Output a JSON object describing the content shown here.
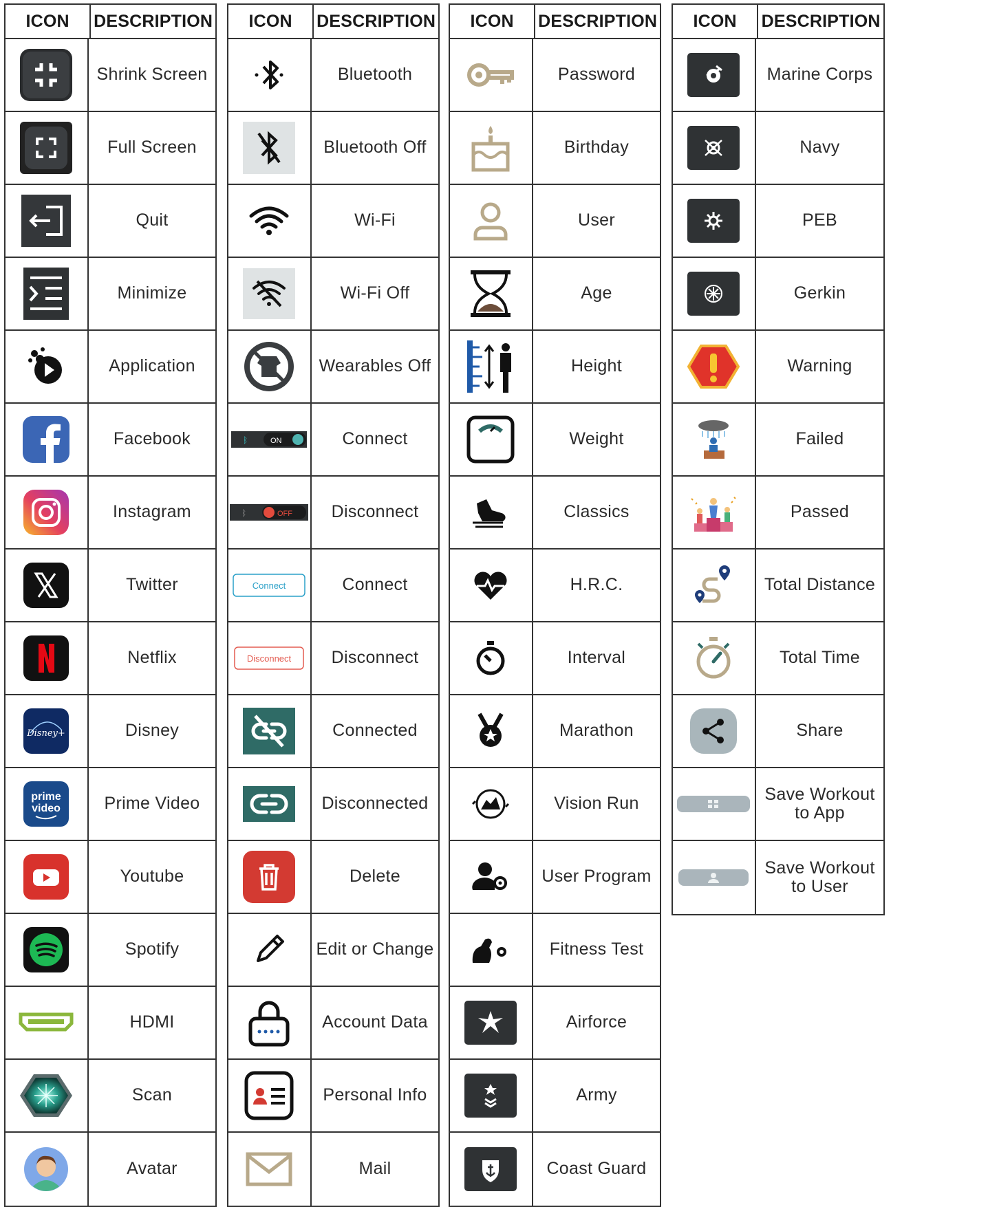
{
  "tables": [
    {
      "header": {
        "icon": "ICON",
        "description": "DESCRIPTION"
      },
      "rows": [
        {
          "icon": "shrink-screen-icon",
          "label": "Shrink Screen"
        },
        {
          "icon": "full-screen-icon",
          "label": "Full Screen"
        },
        {
          "icon": "quit-icon",
          "label": "Quit"
        },
        {
          "icon": "minimize-icon",
          "label": "Minimize"
        },
        {
          "icon": "application-icon",
          "label": "Application"
        },
        {
          "icon": "facebook-icon",
          "label": "Facebook"
        },
        {
          "icon": "instagram-icon",
          "label": "Instagram"
        },
        {
          "icon": "twitter-icon",
          "label": "Twitter"
        },
        {
          "icon": "netflix-icon",
          "label": "Netflix"
        },
        {
          "icon": "disney-icon",
          "label": "Disney",
          "logo_text": "Disney+"
        },
        {
          "icon": "prime-video-icon",
          "label": "Prime Video",
          "logo_text": "prime video"
        },
        {
          "icon": "youtube-icon",
          "label": "Youtube"
        },
        {
          "icon": "spotify-icon",
          "label": "Spotify"
        },
        {
          "icon": "hdmi-icon",
          "label": "HDMI"
        },
        {
          "icon": "scan-icon",
          "label": "Scan"
        },
        {
          "icon": "avatar-icon",
          "label": "Avatar"
        }
      ]
    },
    {
      "header": {
        "icon": "ICON",
        "description": "DESCRIPTION"
      },
      "rows": [
        {
          "icon": "bluetooth-icon",
          "label": "Bluetooth"
        },
        {
          "icon": "bluetooth-off-icon",
          "label": "Bluetooth Off"
        },
        {
          "icon": "wifi-icon",
          "label": "Wi-Fi"
        },
        {
          "icon": "wifi-off-icon",
          "label": "Wi-Fi Off"
        },
        {
          "icon": "wearables-off-icon",
          "label": "Wearables Off"
        },
        {
          "icon": "connect-toggle-icon",
          "label": "Connect",
          "toggle_text": "ON"
        },
        {
          "icon": "disconnect-toggle-icon",
          "label": "Disconnect",
          "toggle_text": "OFF"
        },
        {
          "icon": "connect-button-icon",
          "label": "Connect",
          "button_text": "Connect"
        },
        {
          "icon": "disconnect-button-icon",
          "label": "Disconnect",
          "button_text": "Disconnect"
        },
        {
          "icon": "connected-icon",
          "label": "Connected"
        },
        {
          "icon": "disconnected-icon",
          "label": "Disconnected"
        },
        {
          "icon": "delete-icon",
          "label": "Delete"
        },
        {
          "icon": "edit-icon",
          "label": "Edit or Change"
        },
        {
          "icon": "account-data-icon",
          "label": "Account Data"
        },
        {
          "icon": "personal-info-icon",
          "label": "Personal Info"
        },
        {
          "icon": "mail-icon",
          "label": "Mail"
        }
      ]
    },
    {
      "header": {
        "icon": "ICON",
        "description": "DESCRIPTION"
      },
      "rows": [
        {
          "icon": "password-icon",
          "label": "Password"
        },
        {
          "icon": "birthday-icon",
          "label": "Birthday"
        },
        {
          "icon": "user-icon",
          "label": "User"
        },
        {
          "icon": "age-icon",
          "label": "Age"
        },
        {
          "icon": "height-icon",
          "label": "Height"
        },
        {
          "icon": "weight-icon",
          "label": "Weight"
        },
        {
          "icon": "classics-icon",
          "label": "Classics"
        },
        {
          "icon": "hrc-icon",
          "label": "H.R.C."
        },
        {
          "icon": "interval-icon",
          "label": "Interval"
        },
        {
          "icon": "marathon-icon",
          "label": "Marathon"
        },
        {
          "icon": "vision-run-icon",
          "label": "Vision Run"
        },
        {
          "icon": "user-program-icon",
          "label": "User Program"
        },
        {
          "icon": "fitness-test-icon",
          "label": "Fitness Test"
        },
        {
          "icon": "airforce-icon",
          "label": "Airforce"
        },
        {
          "icon": "army-icon",
          "label": "Army"
        },
        {
          "icon": "coast-guard-icon",
          "label": "Coast Guard"
        }
      ]
    },
    {
      "header": {
        "icon": "ICON",
        "description": "DESCRIPTION"
      },
      "rows": [
        {
          "icon": "marine-corps-icon",
          "label": "Marine Corps"
        },
        {
          "icon": "navy-icon",
          "label": "Navy"
        },
        {
          "icon": "peb-icon",
          "label": "PEB"
        },
        {
          "icon": "gerkin-icon",
          "label": "Gerkin"
        },
        {
          "icon": "warning-icon",
          "label": "Warning"
        },
        {
          "icon": "failed-icon",
          "label": "Failed"
        },
        {
          "icon": "passed-icon",
          "label": "Passed"
        },
        {
          "icon": "total-distance-icon",
          "label": "Total Distance"
        },
        {
          "icon": "total-time-icon",
          "label": "Total Time"
        },
        {
          "icon": "share-icon",
          "label": "Share"
        },
        {
          "icon": "save-workout-app-icon",
          "label": "Save Workout to App"
        },
        {
          "icon": "save-workout-user-icon",
          "label": "Save Workout to User"
        }
      ]
    }
  ],
  "colors": {
    "border": "#333333",
    "dark_tile": "#2f3234",
    "gold": "#b8a98a",
    "teal": "#2f6b66",
    "red": "#d33a32",
    "blue": "#1f5aa8"
  }
}
